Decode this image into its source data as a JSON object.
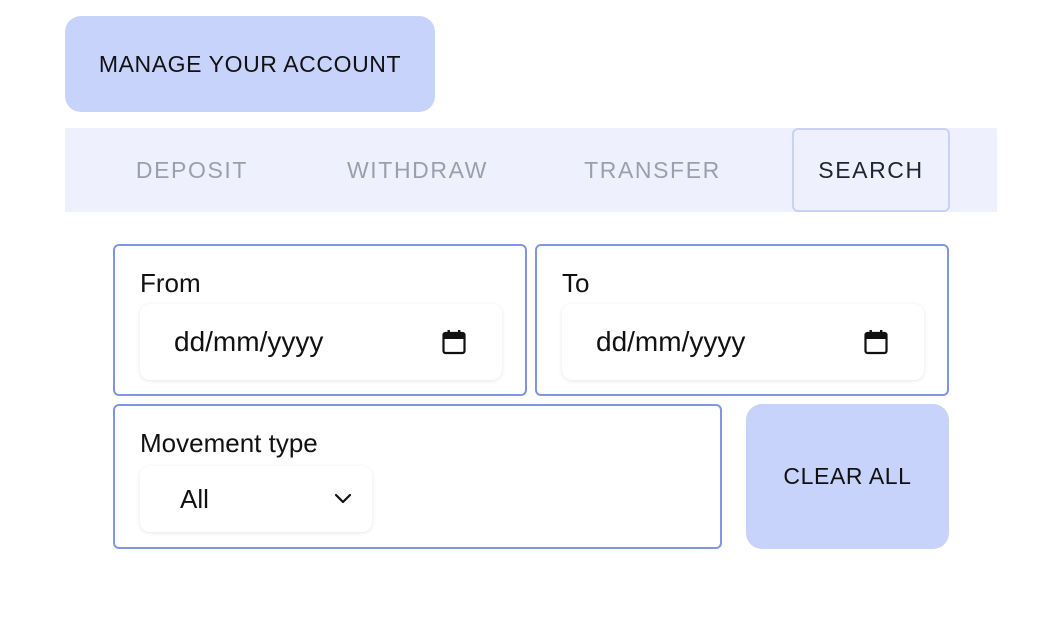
{
  "header": {
    "manage_label": "MANAGE YOUR ACCOUNT"
  },
  "tabs": [
    {
      "label": "DEPOSIT",
      "active": false
    },
    {
      "label": "WITHDRAW",
      "active": false
    },
    {
      "label": "TRANSFER",
      "active": false
    },
    {
      "label": "SEARCH",
      "active": true
    }
  ],
  "filters": {
    "from": {
      "label": "From",
      "placeholder": "dd/mm/yyyy",
      "icon": "calendar-icon"
    },
    "to": {
      "label": "To",
      "placeholder": "dd/mm/yyyy",
      "icon": "calendar-icon"
    },
    "movement_type": {
      "label": "Movement type",
      "selected": "All",
      "icon": "chevron-down-icon"
    },
    "clear_label": "CLEAR ALL"
  },
  "colors": {
    "accent_button": "#c8d3fb",
    "tab_bar_bg": "#eef1fd",
    "box_border": "#7f95e6",
    "tab_inactive_text": "#9aa0ab",
    "tab_active_text": "#1e2433"
  }
}
